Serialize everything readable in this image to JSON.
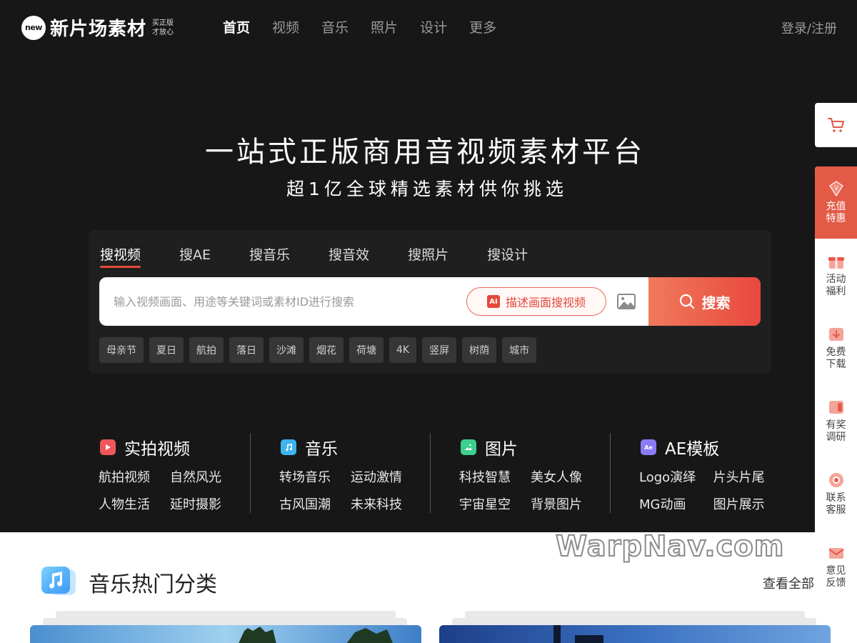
{
  "header": {
    "logo_badge": "new",
    "logo_text": "新片场素材",
    "slogan_line1": "买正版",
    "slogan_line2": "才放心",
    "nav": [
      "首页",
      "视频",
      "音乐",
      "照片",
      "设计",
      "更多"
    ],
    "login": "登录/注册"
  },
  "hero": {
    "title": "一站式正版商用音视频素材平台",
    "subtitle": "超1亿全球精选素材供你挑选"
  },
  "search": {
    "tabs": [
      "搜视频",
      "搜AE",
      "搜音乐",
      "搜音效",
      "搜照片",
      "搜设计"
    ],
    "placeholder": "输入视频画面、用途等关键词或素材ID进行搜索",
    "ai_badge": "AI",
    "ai_label": "描述画面搜视频",
    "button": "搜索",
    "hot_tags": [
      "母亲节",
      "夏日",
      "航拍",
      "落日",
      "沙滩",
      "烟花",
      "荷塘",
      "4K",
      "竖屏",
      "树荫",
      "城市"
    ]
  },
  "categories": [
    {
      "title": "实拍视频",
      "color": "#f0575a",
      "links": [
        "航拍视频",
        "自然风光",
        "人物生活",
        "延时摄影"
      ]
    },
    {
      "title": "音乐",
      "color": "#3db4f0",
      "links": [
        "转场音乐",
        "运动激情",
        "古风国潮",
        "未来科技"
      ]
    },
    {
      "title": "图片",
      "color": "#3ccf8e",
      "links": [
        "科技智慧",
        "美女人像",
        "宇宙星空",
        "背景图片"
      ]
    },
    {
      "title": "AE模板",
      "color": "#8b7cf6",
      "links": [
        "Logo演绎",
        "片头片尾",
        "MG动画",
        "图片展示"
      ]
    }
  ],
  "section": {
    "title": "音乐热门分类",
    "view_all": "查看全部"
  },
  "sidebar": {
    "items": [
      {
        "label1": "充值",
        "label2": "特惠"
      },
      {
        "label1": "活动",
        "label2": "福利"
      },
      {
        "label1": "免费",
        "label2": "下载"
      },
      {
        "label1": "有奖",
        "label2": "调研"
      },
      {
        "label1": "联系",
        "label2": "客服"
      },
      {
        "label1": "意见",
        "label2": "反馈"
      }
    ]
  },
  "watermark": "WarpNav.com",
  "colors": {
    "accent": "#e8483e",
    "background": "#171717"
  }
}
